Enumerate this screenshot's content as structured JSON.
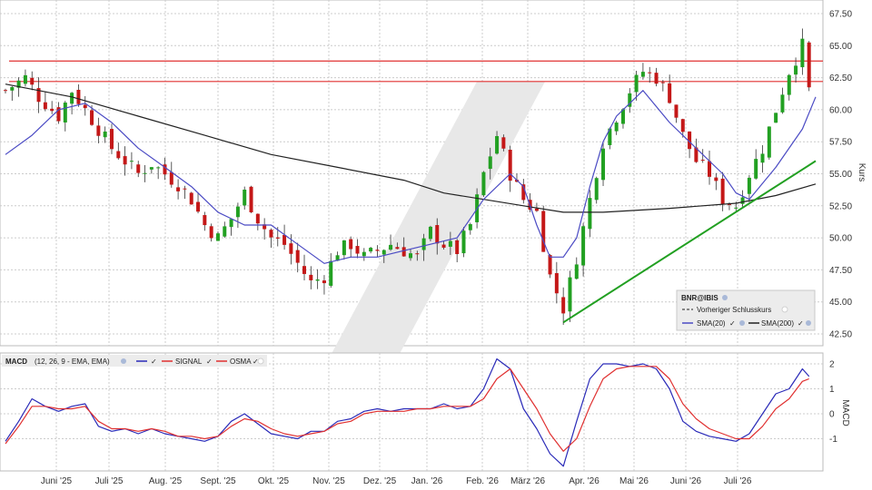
{
  "chart_data": [
    {
      "type": "candlestick",
      "symbol": "BNR@IBIS",
      "ylabel": "Kurs",
      "ylim": [
        42.5,
        67.5
      ],
      "yticks": [
        "42.50",
        "45.00",
        "47.50",
        "50.00",
        "52.50",
        "55.00",
        "57.50",
        "60.00",
        "62.50",
        "65.00",
        "67.50"
      ],
      "x_labels": [
        "Juni '25",
        "Juli '25",
        "Aug. '25",
        "Sept. '25",
        "Okt. '25",
        "Nov. '25",
        "Dez. '25",
        "Jan. '26",
        "Feb. '26",
        "März '26",
        "Apr. '26",
        "Mai '26",
        "Juni '26",
        "Juli '26"
      ],
      "legend": [
        {
          "label": "Vorheriger Schlusskurs"
        },
        {
          "label": "SMA(20)",
          "color": "#4b4bc4"
        },
        {
          "label": "SMA(200)",
          "color": "#222222"
        }
      ],
      "close_path": [
        [
          0,
          61.5
        ],
        [
          3,
          62.5
        ],
        [
          5,
          61.0
        ],
        [
          8,
          59.5
        ],
        [
          10,
          61.5
        ],
        [
          12,
          60.0
        ],
        [
          14,
          58.5
        ],
        [
          16,
          57.0
        ],
        [
          18,
          56.0
        ],
        [
          20,
          55.0
        ],
        [
          22,
          55.8
        ],
        [
          24,
          55.0
        ],
        [
          26,
          54.2
        ],
        [
          28,
          53.0
        ],
        [
          30,
          51.0
        ],
        [
          32,
          50.0
        ],
        [
          34,
          51.5
        ],
        [
          36,
          53.5
        ],
        [
          38,
          51.5
        ],
        [
          40,
          50.0
        ],
        [
          42,
          49.5
        ],
        [
          44,
          48.0
        ],
        [
          46,
          46.5
        ],
        [
          48,
          47.0
        ],
        [
          50,
          49.0
        ],
        [
          52,
          49.5
        ],
        [
          54,
          48.5
        ],
        [
          56,
          49.0
        ],
        [
          58,
          49.5
        ],
        [
          60,
          49.0
        ],
        [
          62,
          48.5
        ],
        [
          64,
          50.5
        ],
        [
          66,
          49.5
        ],
        [
          68,
          49.0
        ],
        [
          70,
          51.0
        ],
        [
          72,
          55.0
        ],
        [
          74,
          58.0
        ],
        [
          76,
          55.0
        ],
        [
          78,
          53.0
        ],
        [
          80,
          52.0
        ],
        [
          82,
          47.0
        ],
        [
          84,
          44.5
        ],
        [
          86,
          48.5
        ],
        [
          88,
          53.0
        ],
        [
          90,
          57.5
        ],
        [
          92,
          59.5
        ],
        [
          94,
          61.5
        ],
        [
          96,
          63.0
        ],
        [
          98,
          62.5
        ],
        [
          100,
          61.0
        ],
        [
          102,
          58.0
        ],
        [
          104,
          56.0
        ],
        [
          106,
          55.0
        ],
        [
          108,
          53.0
        ],
        [
          110,
          52.5
        ],
        [
          112,
          55.0
        ],
        [
          114,
          57.0
        ],
        [
          116,
          60.0
        ],
        [
          118,
          63.0
        ],
        [
          120,
          65.0
        ],
        [
          121,
          61.5
        ]
      ],
      "sma20_path": [
        [
          0,
          56.5
        ],
        [
          4,
          58.0
        ],
        [
          8,
          60.0
        ],
        [
          12,
          60.5
        ],
        [
          16,
          59.0
        ],
        [
          20,
          57.0
        ],
        [
          24,
          55.5
        ],
        [
          28,
          54.0
        ],
        [
          32,
          52.0
        ],
        [
          36,
          51.0
        ],
        [
          40,
          51.0
        ],
        [
          44,
          49.5
        ],
        [
          48,
          48.0
        ],
        [
          52,
          48.5
        ],
        [
          56,
          48.5
        ],
        [
          60,
          49.0
        ],
        [
          64,
          49.5
        ],
        [
          68,
          50.0
        ],
        [
          72,
          53.0
        ],
        [
          76,
          55.0
        ],
        [
          78,
          54.0
        ],
        [
          80,
          51.0
        ],
        [
          82,
          48.5
        ],
        [
          84,
          48.5
        ],
        [
          86,
          50.0
        ],
        [
          88,
          54.0
        ],
        [
          90,
          57.5
        ],
        [
          92,
          59.5
        ],
        [
          96,
          61.5
        ],
        [
          100,
          59.0
        ],
        [
          104,
          57.0
        ],
        [
          108,
          55.0
        ],
        [
          110,
          53.5
        ],
        [
          112,
          53.0
        ],
        [
          116,
          55.5
        ],
        [
          120,
          58.5
        ],
        [
          122,
          61.0
        ]
      ],
      "sma200_path": [
        [
          0,
          62.0
        ],
        [
          10,
          61.0
        ],
        [
          20,
          59.5
        ],
        [
          30,
          58.0
        ],
        [
          40,
          56.5
        ],
        [
          50,
          55.5
        ],
        [
          60,
          54.5
        ],
        [
          66,
          53.5
        ],
        [
          72,
          53.0
        ],
        [
          78,
          52.5
        ],
        [
          84,
          52.0
        ],
        [
          90,
          52.0
        ],
        [
          100,
          52.3
        ],
        [
          110,
          52.7
        ],
        [
          116,
          53.3
        ],
        [
          122,
          54.2
        ]
      ],
      "horizontal_lines": [
        {
          "value": 63.8,
          "color": "#e03030"
        },
        {
          "value": 62.2,
          "color": "#e03030"
        }
      ],
      "trendline": {
        "from": [
          84,
          43.4
        ],
        "to": [
          122,
          56.0
        ],
        "color": "#22a022"
      }
    },
    {
      "type": "line",
      "title": "MACD",
      "params": "(12, 26, 9 - EMA, EMA)",
      "ylabel": "MACD",
      "ylim": [
        -2,
        2
      ],
      "yticks": [
        "-1",
        "0",
        "1",
        "2"
      ],
      "legend": [
        {
          "label": "SIGNAL",
          "color": "#e03030"
        },
        {
          "label": "OSMA",
          "color": "#ffffff"
        }
      ],
      "series": [
        {
          "role": "macd",
          "color": "#2a2ab8",
          "points": [
            [
              0,
              -1.1
            ],
            [
              2,
              -0.3
            ],
            [
              4,
              0.6
            ],
            [
              6,
              0.3
            ],
            [
              8,
              0.1
            ],
            [
              10,
              0.3
            ],
            [
              12,
              0.4
            ],
            [
              14,
              -0.5
            ],
            [
              16,
              -0.7
            ],
            [
              18,
              -0.6
            ],
            [
              20,
              -0.8
            ],
            [
              22,
              -0.6
            ],
            [
              24,
              -0.8
            ],
            [
              26,
              -0.9
            ],
            [
              28,
              -1.0
            ],
            [
              30,
              -1.1
            ],
            [
              32,
              -0.9
            ],
            [
              34,
              -0.3
            ],
            [
              36,
              0.0
            ],
            [
              38,
              -0.4
            ],
            [
              40,
              -0.8
            ],
            [
              42,
              -0.9
            ],
            [
              44,
              -1.0
            ],
            [
              46,
              -0.7
            ],
            [
              48,
              -0.7
            ],
            [
              50,
              -0.3
            ],
            [
              52,
              -0.2
            ],
            [
              54,
              0.1
            ],
            [
              56,
              0.2
            ],
            [
              58,
              0.1
            ],
            [
              60,
              0.2
            ],
            [
              62,
              0.2
            ],
            [
              64,
              0.2
            ],
            [
              66,
              0.4
            ],
            [
              68,
              0.2
            ],
            [
              70,
              0.3
            ],
            [
              72,
              1.0
            ],
            [
              74,
              2.2
            ],
            [
              76,
              1.8
            ],
            [
              78,
              0.2
            ],
            [
              80,
              -0.6
            ],
            [
              82,
              -1.6
            ],
            [
              84,
              -2.1
            ],
            [
              86,
              -0.3
            ],
            [
              88,
              1.4
            ],
            [
              90,
              2.0
            ],
            [
              92,
              2.0
            ],
            [
              94,
              1.9
            ],
            [
              96,
              2.0
            ],
            [
              98,
              1.8
            ],
            [
              100,
              1.0
            ],
            [
              102,
              -0.3
            ],
            [
              104,
              -0.7
            ],
            [
              106,
              -0.9
            ],
            [
              108,
              -1.0
            ],
            [
              110,
              -1.1
            ],
            [
              112,
              -0.8
            ],
            [
              114,
              0.0
            ],
            [
              116,
              0.8
            ],
            [
              118,
              1.0
            ],
            [
              120,
              1.8
            ],
            [
              121,
              1.5
            ]
          ]
        },
        {
          "role": "signal",
          "color": "#e03030",
          "points": [
            [
              0,
              -1.2
            ],
            [
              2,
              -0.5
            ],
            [
              4,
              0.3
            ],
            [
              6,
              0.3
            ],
            [
              8,
              0.2
            ],
            [
              10,
              0.2
            ],
            [
              12,
              0.3
            ],
            [
              14,
              -0.3
            ],
            [
              16,
              -0.6
            ],
            [
              18,
              -0.6
            ],
            [
              20,
              -0.7
            ],
            [
              22,
              -0.6
            ],
            [
              24,
              -0.7
            ],
            [
              26,
              -0.9
            ],
            [
              28,
              -0.9
            ],
            [
              30,
              -1.0
            ],
            [
              32,
              -0.9
            ],
            [
              34,
              -0.5
            ],
            [
              36,
              -0.2
            ],
            [
              38,
              -0.3
            ],
            [
              40,
              -0.6
            ],
            [
              42,
              -0.8
            ],
            [
              44,
              -0.9
            ],
            [
              46,
              -0.8
            ],
            [
              48,
              -0.7
            ],
            [
              50,
              -0.4
            ],
            [
              52,
              -0.3
            ],
            [
              54,
              0.0
            ],
            [
              56,
              0.1
            ],
            [
              58,
              0.1
            ],
            [
              60,
              0.1
            ],
            [
              62,
              0.2
            ],
            [
              64,
              0.2
            ],
            [
              66,
              0.3
            ],
            [
              68,
              0.3
            ],
            [
              70,
              0.3
            ],
            [
              72,
              0.6
            ],
            [
              74,
              1.4
            ],
            [
              76,
              1.8
            ],
            [
              78,
              1.0
            ],
            [
              80,
              0.2
            ],
            [
              82,
              -0.8
            ],
            [
              84,
              -1.5
            ],
            [
              86,
              -1.0
            ],
            [
              88,
              0.3
            ],
            [
              90,
              1.4
            ],
            [
              92,
              1.8
            ],
            [
              94,
              1.9
            ],
            [
              96,
              1.9
            ],
            [
              98,
              1.9
            ],
            [
              100,
              1.4
            ],
            [
              102,
              0.4
            ],
            [
              104,
              -0.2
            ],
            [
              106,
              -0.6
            ],
            [
              108,
              -0.8
            ],
            [
              110,
              -1.0
            ],
            [
              112,
              -1.0
            ],
            [
              114,
              -0.5
            ],
            [
              116,
              0.2
            ],
            [
              118,
              0.6
            ],
            [
              120,
              1.3
            ],
            [
              121,
              1.4
            ]
          ]
        }
      ]
    }
  ]
}
